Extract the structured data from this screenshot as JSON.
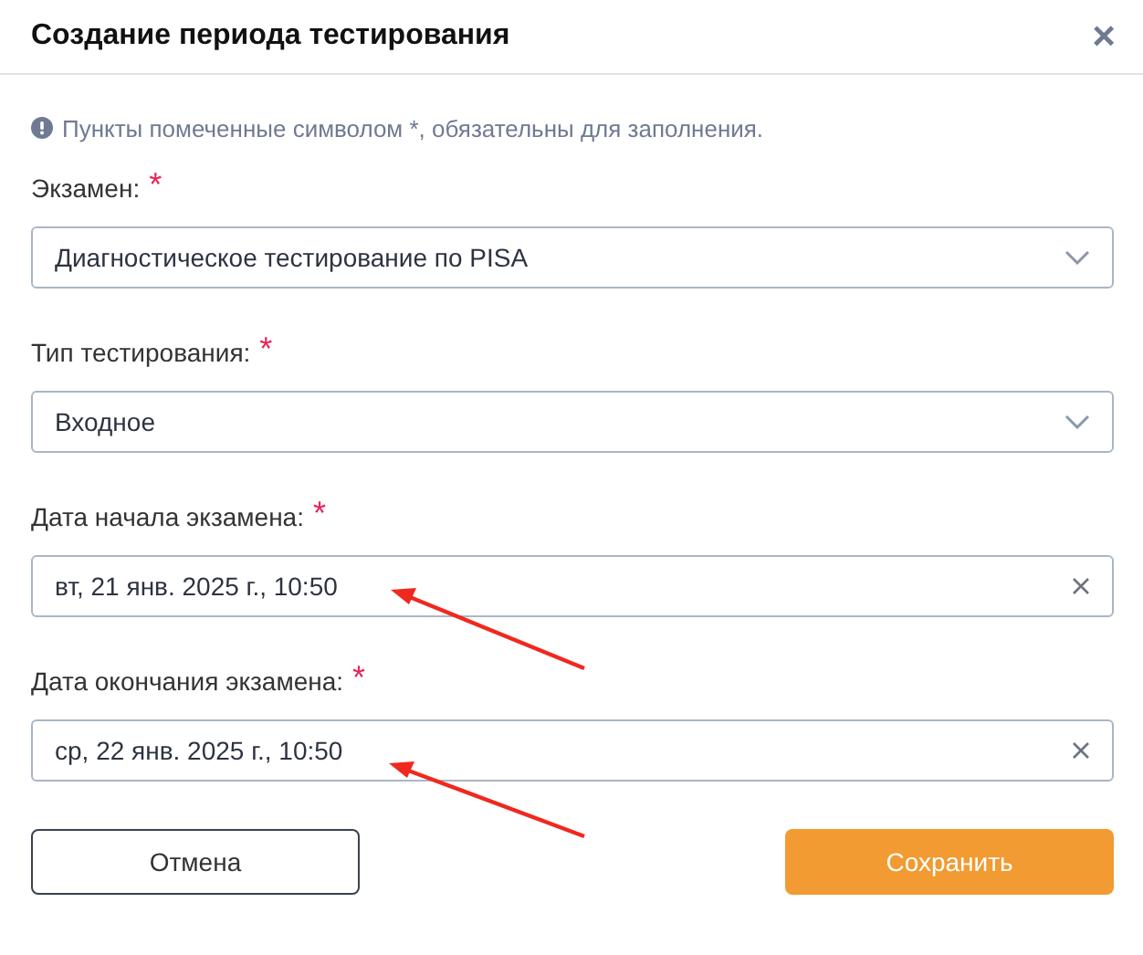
{
  "dialog": {
    "title": "Создание периода тестирования",
    "close": "×"
  },
  "note": "Пункты помеченные символом *, обязательны для заполнения.",
  "fields": [
    {
      "kind": "select",
      "label": "Экзамен:",
      "required_mark": "*",
      "value": "Диагностическое тестирование по PISA"
    },
    {
      "kind": "select",
      "label": "Тип тестирования:",
      "required_mark": "*",
      "value": "Входное"
    },
    {
      "kind": "date",
      "label": "Дата начала экзамена:",
      "required_mark": "*",
      "value": "вт, 21 янв. 2025 г., 10:50"
    },
    {
      "kind": "date",
      "label": "Дата окончания экзамена:",
      "required_mark": "*",
      "value": "ср, 22 янв. 2025 г., 10:50"
    }
  ],
  "buttons": [
    {
      "kind": "secondary",
      "label": "Отмена"
    },
    {
      "kind": "primary",
      "label": "Сохранить"
    }
  ]
}
